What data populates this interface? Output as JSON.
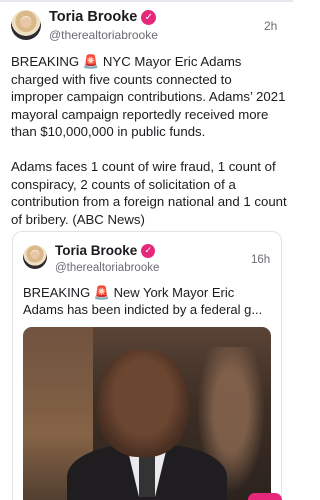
{
  "post": {
    "name": "Toria Brooke",
    "handle": "@therealtoriabrooke",
    "time": "2h",
    "text": "BREAKING 🚨 NYC Mayor Eric Adams charged with five counts connected to improper campaign contributions. Adams’ 2021 mayoral campaign reportedly received more than $10,000,000 in public funds.\n\nAdams faces 1 count of wire fraud, 1 count of conspiracy, 2 counts of solicitation of a contribution from a foreign national and 1 count of bribery. (ABC News)"
  },
  "quote": {
    "name": "Toria Brooke",
    "handle": "@therealtoriabrooke",
    "time": "16h",
    "text_line1": "BREAKING 🚨 New York Mayor Eric",
    "text_line2": "Adams has been indicted by a federal g..."
  },
  "icons": {
    "verified": "check-badge-icon"
  },
  "colors": {
    "accent": "#e6287a",
    "muted": "#6b6b73"
  }
}
